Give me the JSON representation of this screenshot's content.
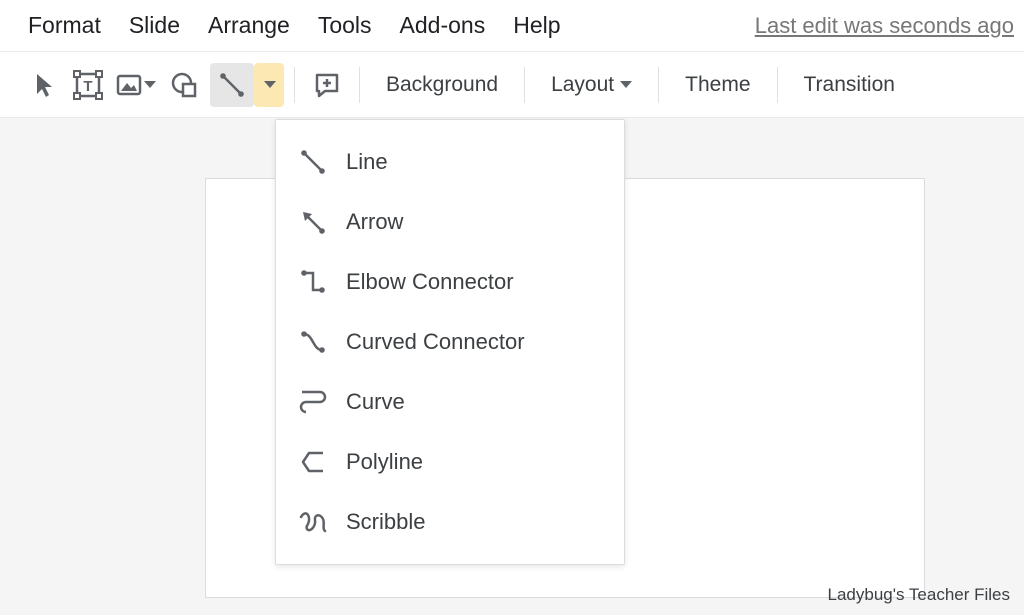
{
  "menubar": {
    "items": [
      "Format",
      "Slide",
      "Arrange",
      "Tools",
      "Add-ons",
      "Help"
    ],
    "edit_status": "Last edit was seconds ago"
  },
  "toolbar": {
    "background_label": "Background",
    "layout_label": "Layout",
    "theme_label": "Theme",
    "transition_label": "Transition"
  },
  "line_menu": {
    "items": [
      {
        "id": "line",
        "label": "Line"
      },
      {
        "id": "arrow",
        "label": "Arrow"
      },
      {
        "id": "elbow-connector",
        "label": "Elbow Connector"
      },
      {
        "id": "curved-connector",
        "label": "Curved Connector"
      },
      {
        "id": "curve",
        "label": "Curve"
      },
      {
        "id": "polyline",
        "label": "Polyline"
      },
      {
        "id": "scribble",
        "label": "Scribble"
      }
    ]
  },
  "attribution": "Ladybug's Teacher Files"
}
